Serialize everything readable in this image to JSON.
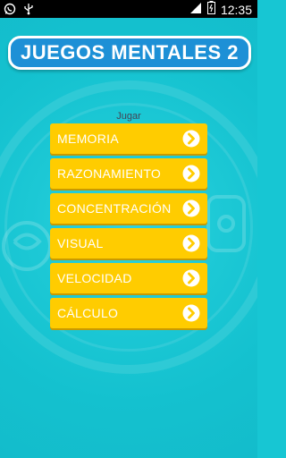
{
  "statusbar": {
    "time": "12:35",
    "left_icons": [
      "whatsapp-icon",
      "usb-icon"
    ],
    "right_icons": [
      "signal-icon",
      "battery-icon"
    ]
  },
  "header": {
    "title": "JUEGOS MENTALES 2"
  },
  "main": {
    "subtitle": "Jugar",
    "menu": [
      {
        "label": "MEMORIA"
      },
      {
        "label": "RAZONAMIENTO"
      },
      {
        "label": "CONCENTRACIÓN"
      },
      {
        "label": "VISUAL"
      },
      {
        "label": "VELOCIDAD"
      },
      {
        "label": "CÁLCULO"
      }
    ],
    "arrow_icon": "chevron-right-circle-icon"
  },
  "colors": {
    "background": "#17c6d3",
    "title_bar": "#1d90d6",
    "menu_button": "#ffcc00"
  }
}
